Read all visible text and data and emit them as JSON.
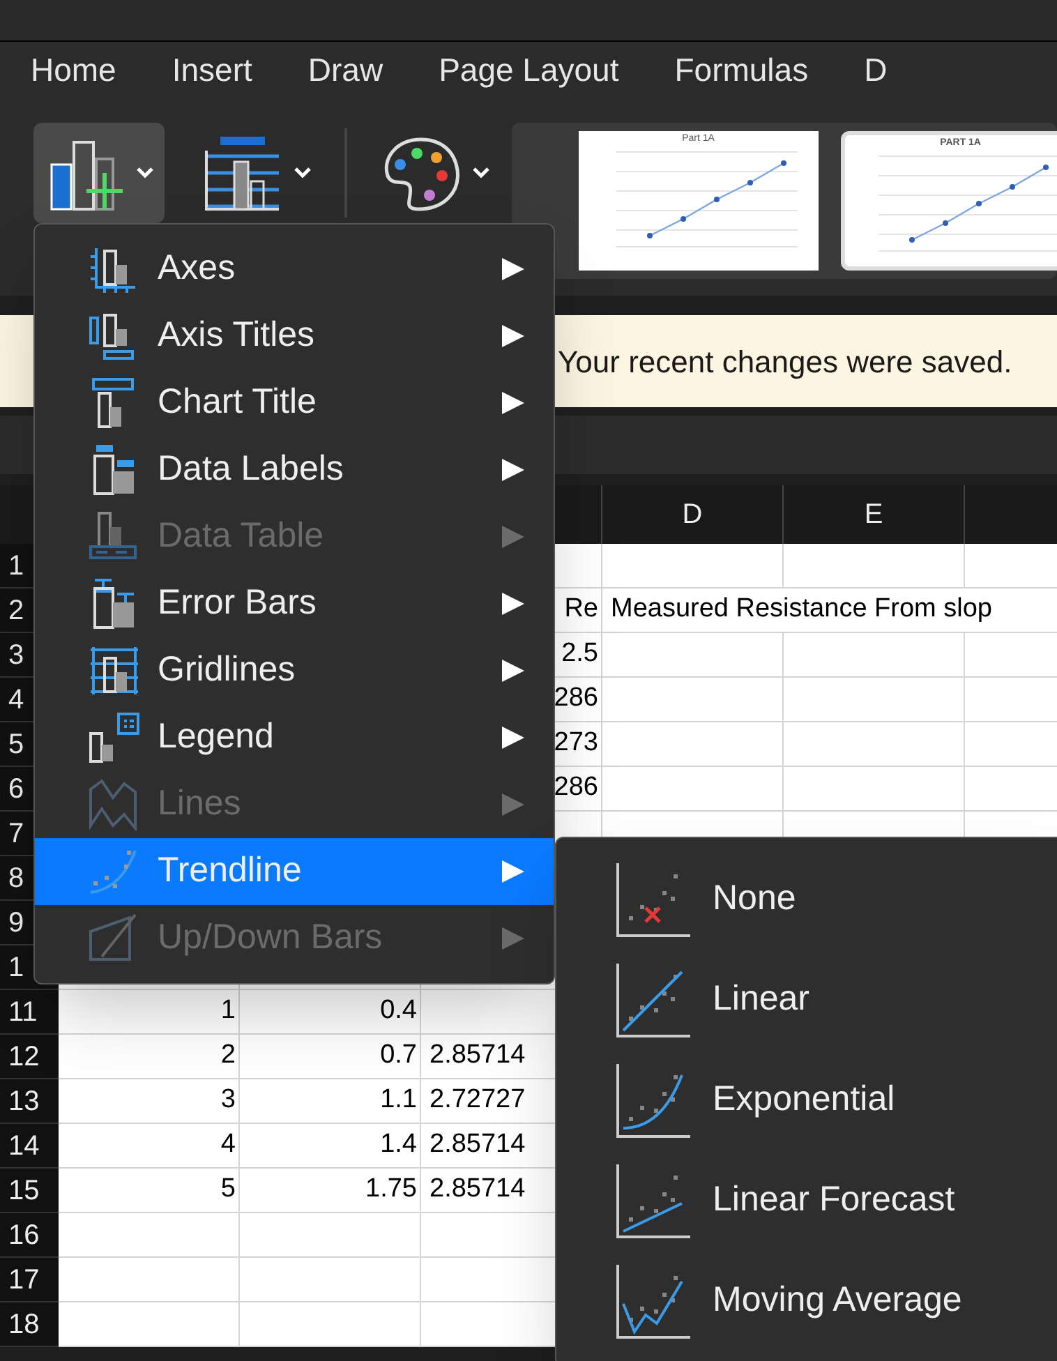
{
  "tabs": [
    {
      "label": "Home"
    },
    {
      "label": "Insert"
    },
    {
      "label": "Draw"
    },
    {
      "label": "Page Layout"
    },
    {
      "label": "Formulas"
    },
    {
      "label": "D"
    }
  ],
  "ribbon": {
    "gallery": [
      {
        "title": "Part 1A",
        "selected": false
      },
      {
        "title": "PART 1A",
        "selected": true
      }
    ]
  },
  "notification": "Your recent changes were saved.",
  "menu": [
    {
      "label": "Axes",
      "disabled": false,
      "selected": false
    },
    {
      "label": "Axis Titles",
      "disabled": false,
      "selected": false
    },
    {
      "label": "Chart Title",
      "disabled": false,
      "selected": false
    },
    {
      "label": "Data Labels",
      "disabled": false,
      "selected": false
    },
    {
      "label": "Data Table",
      "disabled": true,
      "selected": false
    },
    {
      "label": "Error Bars",
      "disabled": false,
      "selected": false
    },
    {
      "label": "Gridlines",
      "disabled": false,
      "selected": false
    },
    {
      "label": "Legend",
      "disabled": false,
      "selected": false
    },
    {
      "label": "Lines",
      "disabled": true,
      "selected": false
    },
    {
      "label": "Trendline",
      "disabled": false,
      "selected": true
    },
    {
      "label": "Up/Down Bars",
      "disabled": true,
      "selected": false
    }
  ],
  "submenu": [
    {
      "label": "None"
    },
    {
      "label": "Linear"
    },
    {
      "label": "Exponential"
    },
    {
      "label": "Linear Forecast"
    },
    {
      "label": "Moving Average"
    }
  ],
  "sheet": {
    "columns": [
      "D",
      "E"
    ],
    "rows": [
      {
        "number": "1"
      },
      {
        "number": "2",
        "cells": {
          "C": {
            "text": "Re",
            "kind": "number"
          },
          "D": {
            "text": "Measured Resistance From slop",
            "kind": "text"
          }
        }
      },
      {
        "number": "3",
        "cells": {
          "C": {
            "text": "2.5",
            "kind": "number"
          }
        }
      },
      {
        "number": "4",
        "cells": {
          "C": {
            "text": "286",
            "kind": "number"
          }
        }
      },
      {
        "number": "5",
        "cells": {
          "C": {
            "text": "273",
            "kind": "number"
          }
        }
      },
      {
        "number": "6",
        "cells": {
          "C": {
            "text": "286",
            "kind": "number"
          }
        }
      },
      {
        "number": "7"
      },
      {
        "number": "8"
      },
      {
        "number": "9"
      },
      {
        "number": "1"
      },
      {
        "number": "11",
        "cells": {
          "A": {
            "text": "1",
            "kind": "number"
          },
          "B": {
            "text": "0.4",
            "kind": "number"
          }
        }
      },
      {
        "number": "12",
        "cells": {
          "A": {
            "text": "2",
            "kind": "number"
          },
          "B": {
            "text": "0.7",
            "kind": "number"
          },
          "C": {
            "text": "2.85714",
            "kind": "text"
          }
        }
      },
      {
        "number": "13",
        "cells": {
          "A": {
            "text": "3",
            "kind": "number"
          },
          "B": {
            "text": "1.1",
            "kind": "number"
          },
          "C": {
            "text": "2.72727",
            "kind": "text"
          }
        }
      },
      {
        "number": "14",
        "cells": {
          "A": {
            "text": "4",
            "kind": "number"
          },
          "B": {
            "text": "1.4",
            "kind": "number"
          },
          "C": {
            "text": "2.85714",
            "kind": "text"
          }
        }
      },
      {
        "number": "15",
        "cells": {
          "A": {
            "text": "5",
            "kind": "number"
          },
          "B": {
            "text": "1.75",
            "kind": "number"
          },
          "C": {
            "text": "2.85714",
            "kind": "text"
          }
        }
      },
      {
        "number": "16"
      },
      {
        "number": "17"
      },
      {
        "number": "18"
      }
    ]
  }
}
